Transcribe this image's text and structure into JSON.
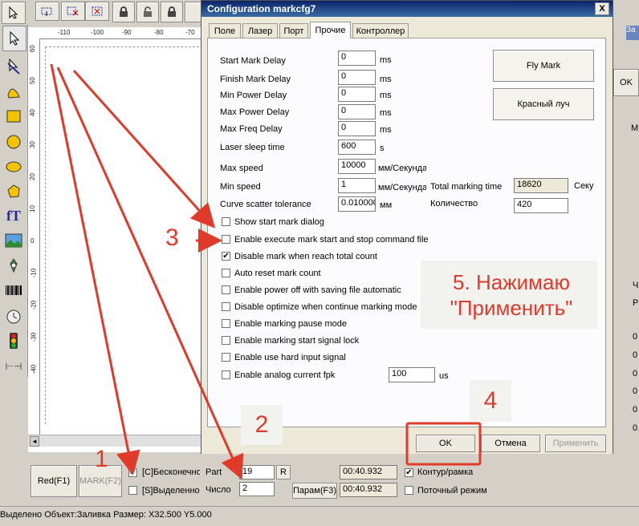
{
  "toolbar_top": {
    "left_icons": [
      "select-tool-icon",
      "node-edit-icon",
      "delete-node-icon"
    ],
    "lock_icons": [
      "lock-icon",
      "lock-icon-2",
      "lock-icon-3",
      "lock-icon-4"
    ]
  },
  "ruler": {
    "top_ticks": [
      "-110",
      "-100",
      "-90",
      "-80",
      "-70"
    ],
    "left_ticks": [
      "60",
      "50",
      "40",
      "30",
      "20",
      "10",
      "0",
      "-10",
      "-20",
      "-30",
      "-40"
    ]
  },
  "dialog": {
    "title": "Configuration markcfg7",
    "tabs": [
      "Поле",
      "Лазер",
      "Порт",
      "Прочие",
      "Контроллер"
    ],
    "active_tab": "Прочие",
    "params": [
      {
        "label": "Start Mark Delay",
        "value": "0",
        "unit": "ms"
      },
      {
        "label": "Finish Mark Delay",
        "value": "0",
        "unit": "ms"
      },
      {
        "label": "Min Power Delay",
        "value": "0",
        "unit": "ms"
      },
      {
        "label": "Max Power Delay",
        "value": "0",
        "unit": "ms"
      },
      {
        "label": "Max Freq Delay",
        "value": "0",
        "unit": "ms"
      },
      {
        "label": "Laser sleep time",
        "value": "600",
        "unit": "s"
      },
      {
        "label": "Max speed",
        "value": "10000",
        "unit": "мм/Секунда"
      },
      {
        "label": "Min speed",
        "value": "1",
        "unit": "мм/Секунда"
      },
      {
        "label": "Curve scatter tolerance",
        "value": "0.010000",
        "unit": "мм"
      }
    ],
    "fly_mark": "Fly Mark",
    "red_light": "Красный луч",
    "total_marking_time_label": "Total marking time",
    "total_marking_time_value": "18620",
    "total_marking_time_unit": "Секу",
    "count_label": "Количество",
    "count_value": "420",
    "checkboxes": [
      {
        "label": "Show start mark dialog",
        "checked": false
      },
      {
        "label": "Enable execute mark start and stop command file",
        "checked": false
      },
      {
        "label": "Disable mark when reach total count",
        "checked": true
      },
      {
        "label": "Auto reset mark count",
        "checked": false
      },
      {
        "label": "Enable power off with saving file automatic",
        "checked": false
      },
      {
        "label": "Disable optimize when continue marking mode",
        "checked": false
      },
      {
        "label": "Enable marking pause mode",
        "checked": false
      },
      {
        "label": "Enable marking start signal lock",
        "checked": false
      },
      {
        "label": "Enable use hard input signal",
        "checked": false
      },
      {
        "label": "Enable analog current fpk",
        "checked": false
      }
    ],
    "analog_value": "100",
    "analog_unit": "us",
    "ok": "OK",
    "cancel": "Отмена",
    "apply": "Применить",
    "close": "X"
  },
  "annotations": {
    "n1": "1",
    "n2": "2",
    "n3": "3",
    "n4": "4",
    "callout": "5. Нажимаю \"Применить\""
  },
  "bottom": {
    "red_btn": "Red(F1)",
    "mark_btn": "MARK(F2)",
    "cb_continuous": "[C]Бесконечно",
    "cb_continuous_checked": true,
    "cb_selected": "[S]Выделенно",
    "part_label": "Part",
    "part_value": "19",
    "r_btn": "R",
    "count_label": "Число",
    "count_value": "2",
    "param_btn": "Парам(F3)",
    "time1": "00:40.932",
    "time2": "00:40.932",
    "cb_contour": "Контур/рамка",
    "cb_contour_checked": true,
    "cb_stream": "Поточный режим"
  },
  "status_bar": "Выделено Объект:Заливка Размер: X32.500 Y5.000",
  "right_panel": {
    "ok_btn": "OK",
    "letters": [
      "М",
      "Ч",
      "Р",
      "0",
      "0",
      "0",
      "0",
      "0",
      "0"
    ],
    "top": "За"
  }
}
